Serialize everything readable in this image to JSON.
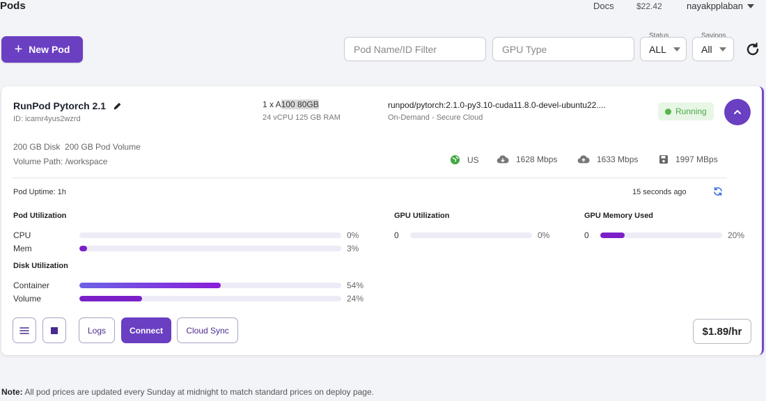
{
  "header": {
    "title": "Pods",
    "docs_label": "Docs",
    "balance": "$22.42",
    "username": "nayakpplaban"
  },
  "toolbar": {
    "new_pod_label": "New Pod",
    "name_filter_placeholder": "Pod Name/ID Filter",
    "gpu_type_placeholder": "GPU Type",
    "status_label": "Status",
    "status_value": "ALL",
    "savings_label": "Savings",
    "savings_value": "All"
  },
  "pod": {
    "name": "RunPod Pytorch 2.1",
    "id_text": "ID: icamr4yus2wzrd",
    "gpu_prefix": "1 x A",
    "gpu_highlight": "100 80GB",
    "cpu_ram": "24 vCPU 125 GB RAM",
    "image": "runpod/pytorch:2.1.0-py3.10-cuda11.8.0-devel-ubuntu22....",
    "cloud": "On-Demand - Secure Cloud",
    "status": "Running",
    "disk_info": "200 GB Disk  200 GB Pod Volume",
    "volume_path": "Volume Path: /workspace",
    "network": {
      "region": "US",
      "download": "1628 Mbps",
      "upload": "1633 Mbps",
      "disk_speed": "1997 MBps"
    },
    "uptime": "Pod Uptime: 1h",
    "updated_ago": "15 seconds ago",
    "pod_utilization": {
      "title": "Pod Utilization",
      "cpu_label": "CPU",
      "cpu_value": "0%",
      "cpu_fraction": 0.0,
      "mem_label": "Mem",
      "mem_value": "3%",
      "mem_fraction": 0.03
    },
    "gpu_utilization": {
      "title": "GPU Utilization",
      "index": "0",
      "value": "0%",
      "fraction": 0.0
    },
    "gpu_memory": {
      "title": "GPU Memory Used",
      "index": "0",
      "value": "20%",
      "fraction": 0.2
    },
    "disk_utilization": {
      "title": "Disk Utilization",
      "container_label": "Container",
      "container_value": "54%",
      "container_fraction": 0.54,
      "volume_label": "Volume",
      "volume_value": "24%",
      "volume_fraction": 0.24
    },
    "actions": {
      "logs": "Logs",
      "connect": "Connect",
      "cloud_sync": "Cloud Sync"
    },
    "price": "$1.89/hr"
  },
  "note": {
    "bold": "Note:",
    "text": " All pod prices are updated every Sunday at midnight to match standard prices on deploy page."
  },
  "colors": {
    "accent": "#6a3fc1",
    "bar_fill": "#7b20c9",
    "running_green": "#56b64a"
  }
}
